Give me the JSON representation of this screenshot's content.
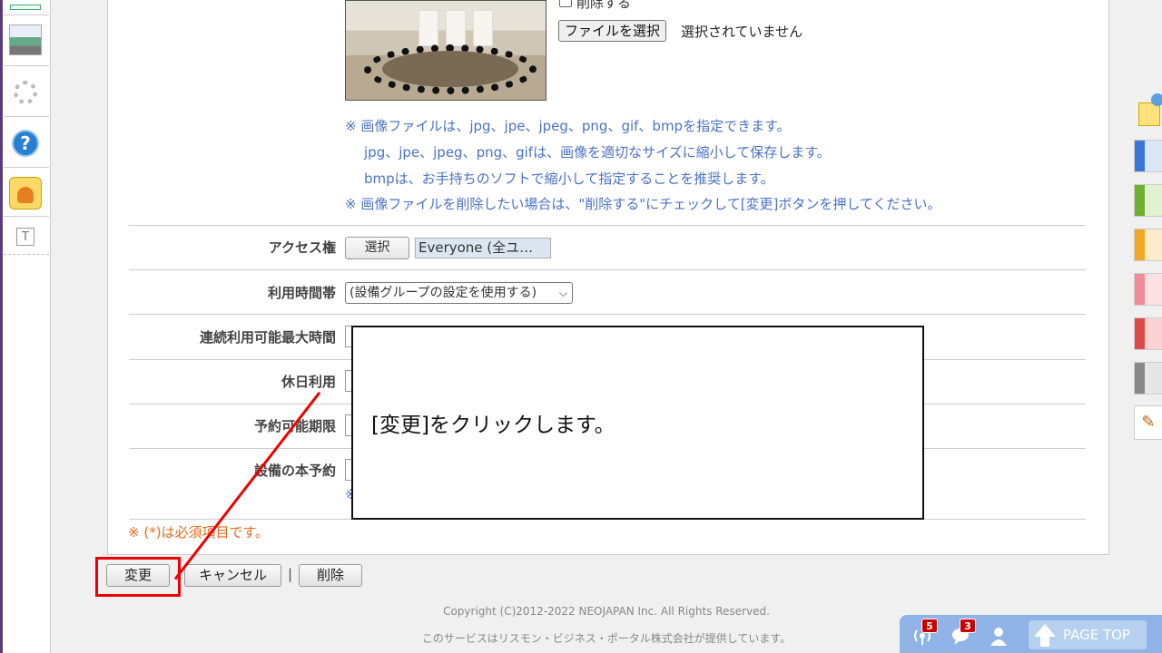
{
  "image_area": {
    "delete_checkbox_label": "削除する",
    "file_button": "ファイルを選択",
    "file_status": "選択されていません",
    "notes": [
      "※ 画像ファイルは、jpg、jpe、jpeg、png、gif、bmpを指定できます。",
      "jpg、jpe、jpeg、png、gifは、画像を適切なサイズに縮小して保存します。",
      "bmpは、お手持ちのソフトで縮小して指定することを推奨します。",
      "※ 画像ファイルを削除したい場合は、\"削除する\"にチェックして[変更]ボタンを押してください。"
    ]
  },
  "form": {
    "colon": "：",
    "access": {
      "label": "アクセス権",
      "select_button": "選択",
      "value": "Everyone (全ユ…"
    },
    "usage_hours": {
      "label": "利用時間帯",
      "selected": "(設備グループの設定を使用する)"
    },
    "max_continuous": {
      "label": "連続利用可能最大時間"
    },
    "holiday_use": {
      "label": "休日利用"
    },
    "reservation_period": {
      "label": "予約可能期限"
    },
    "main_reservation": {
      "label": "設備の本予約",
      "note_mark": "※"
    },
    "required_note": "※ (*)は必須項目です。"
  },
  "actions": {
    "change": "変更",
    "cancel": "キャンセル",
    "delete": "削除",
    "separator": "|"
  },
  "callout": {
    "text": "[変更]をクリックします。"
  },
  "footer": {
    "copyright": "Copyright (C)2012-2022 NEOJAPAN Inc. All Rights Reserved.",
    "provider": "このサービスはリスモン・ビジネス・ポータル株式会社が提供しています。"
  },
  "toolbar": {
    "badge_notifications": "5",
    "badge_messages": "3",
    "page_top": "PAGE TOP"
  },
  "colors": {
    "note_blue": "#4a72c8",
    "required_orange": "#e86a1f",
    "highlight_red": "#e00000",
    "tab_blue": "#3a78d8",
    "tab_green": "#6fb12f",
    "tab_orange": "#f5a623",
    "tab_pink": "#f28b95",
    "tab_red": "#e04848",
    "tab_gray": "#888888"
  }
}
